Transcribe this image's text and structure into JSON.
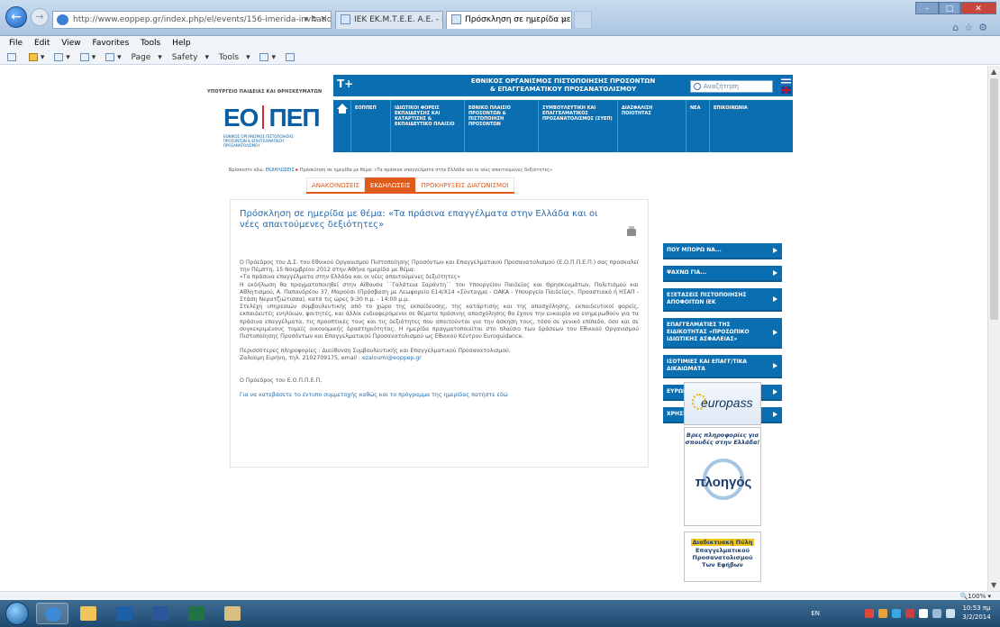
{
  "browser": {
    "address_url": "http://www.eoppep.gr/index.php/el/events/156-imerida-invitation",
    "address_host": "eoppep.gr",
    "tabs": [
      {
        "label": "ΙΕΚ ΕΚ.Μ.Τ.Ε.Ε. Α.Ε. - Ενημέρω..."
      },
      {
        "label": "Πρόσκληση σε ημερίδα με ..."
      }
    ],
    "menu": [
      "File",
      "Edit",
      "View",
      "Favorites",
      "Tools",
      "Help"
    ],
    "commands": [
      "Page",
      "Safety",
      "Tools"
    ],
    "zoom": "100%"
  },
  "site": {
    "ministry": "ΥΠΟΥΡΓΕΙΟ ΠΑΙΔΕΙΑΣ ΚΑΙ ΘΡΗΣΚΕΥΜΑΤΩΝ",
    "logo_left": "ΕΟ",
    "logo_right": "ΠΕΠ",
    "logo_sub": "ΕΘΝΙΚΟΣ ΟΡΓΑΝΙΣΜΟΣ ΠΙΣΤΟΠΟΙΗΣΗΣ ΠΡΟΣΟΝΤΩΝ & ΕΠΑΓΓΕΛΜΑΤΙΚΟΥ ΠΡΟΣΑΝΑΤΟΛΙΣΜΟΥ",
    "text_size": "T+",
    "org_line1": "ΕΘΝΙΚΟΣ ΟΡΓΑΝΙΣΜΟΣ ΠΙΣΤΟΠΟΙΗΣΗΣ ΠΡΟΣΟΝΤΩΝ",
    "org_line2": "& ΕΠΑΓΓΕΛΜΑΤΙΚΟΥ ΠΡΟΣΑΝΑΤΟΛΙΣΜΟΥ",
    "search_placeholder": "Αναζήτηση",
    "menu": [
      "ΕΟΠΠΕΠ",
      "ΙΔΙΩΤΙΚΟΙ ΦΟΡΕΙΣ ΕΚΠΑΙΔΕΥΣΗΣ ΚΑΙ ΚΑΤΑΡΤΙΣΗΣ & ΕΚΠΑΙΔΕΥΤΙΚΟ ΠΛΑΙΣΙΟ",
      "ΕΘΝΙΚΟ ΠΛΑΙΣΙΟ ΠΡΟΣΟΝΤΩΝ & ΠΙΣΤΟΠΟΙΗΣΗ ΠΡΟΣΟΝΤΩΝ",
      "ΣΥΜΒΟΥΛΕΥΤΙΚΗ ΚΑΙ ΕΠΑΓΓΕΛΜΑΤΙΚΟΣ ΠΡΟΣΑΝΑΤΟΛΙΣΜΟΣ (ΣΥΕΠ)",
      "ΔΙΑΣΦΑΛΙΣΗ ΠΟΙΟΤΗΤΑΣ",
      "ΝΕΑ",
      "ΕΠΙΚΟΙΝΩΝΙΑ"
    ]
  },
  "breadcrumb": {
    "prefix": "Βρίσκεστε εδώ:",
    "link": "ΕΚΔΗΛΩΣΕΙΣ",
    "current": "Πρόσκληση σε ημερίδα με θέμα: «Τα πράσινα επαγγέλματα στην Ελλάδα και οι νέες απαιτούμενες δεξιότητες»"
  },
  "subtabs": [
    "ΑΝΑΚΟΙΝΩΣΕΙΣ",
    "ΕΚΔΗΛΩΣΕΙΣ",
    "ΠΡΟΚΗΡΥΞΕΙΣ ΔΙΑΓΩΝΙΣΜΟΙ"
  ],
  "article": {
    "title": "Πρόσκληση σε ημερίδα με θέμα: «Τα πράσινα επαγγέλματα στην Ελλάδα και οι νέες απαιτούμενες δεξιότητες»",
    "p1": "Ο Πρόεδρος του Δ.Σ. του Εθνικού Οργανισμού Πιστοποίησης Προσόντων και Επαγγελματικού Προσανατολισμού (Ε.Ο.Π.Π.Ε.Π.) σας προσκαλεί την Πέμπτη, 15 Νοεμβρίου 2012 στην Αθήνα ημερίδα με θέμα:",
    "p2": "«Τα πράσινα επαγγέλματα στην Ελλάδα και οι νέες απαιτούμενες δεξιότητες»",
    "p3": "Η εκδήλωση θα πραγματοποιηθεί στην Αίθουσα ``Γαλάτεια Σαράντη`` του Υπουργείου Παιδείας και Θρησκευμάτων, Πολιτισμού και Αθλητισμού, Α. Παπανδρέου 37, Μαρούσι (Πρόσβαση με Λεωφορείο Ε14/Χ14 «Σύνταγμα - ΟΑΚΑ - Υπουργείο Παιδείας», Προαστιακό ή ΗΣΑΠ - Στάση Νερατζιώτισσα), κατά τις ώρες 9:30 π.μ. - 14:00 μ.μ.",
    "p4": "Στελέχη υπηρεσιών συμβουλευτικής από το χώρο της εκπαίδευσης, της κατάρτισης και της απασχόλησης, εκπαιδευτικοί φορείς, εκπαιδευτές ενηλίκων, φοιτητές, και άλλοι ενδιαφερόμενοι σε θέματα πράσινης απασχόλησης θα έχουν την ευκαιρία να ενημερωθούν για τα πράσινα επαγγέλματα, τις προοπτικές τους και τις δεξιότητες που απαιτούνται για την άσκηση τους, τόσο σε γενικό επίπεδο, όσο και σε συγκεκριμένους τομείς οικονομικής δραστηριότητας. Η ημερίδα πραγματοποιείται στο πλαίσιο των δράσεων του Εθνικού Οργανισμού Πιστοποίησης Προσόντων και Επαγγελματικού Προσανατολισμού ως Εθνικού Κέντρου Euroguidance.",
    "p5": "Περισσότερες πληροφορίες : Διεύθυνση Συμβουλευτικής και Επαγγελματικού Προσανατολισμού,",
    "p6_prefix": "Ζαλούμη Ειρήνη, τηλ. 2102709175, email :",
    "email": "ezaloumi@eoppep.gr",
    "signature": "Ο Πρόεδρος του Ε.Ο.Π.Π.Ε.Π,",
    "download_link": "Για να κατεβάσετε το έντυπο συμμετοχής καθώς και το πρόγραμμα της ημερίδας πατήστε εδώ"
  },
  "sidebar": {
    "items": [
      "ΠΟΥ ΜΠΟΡΩ ΝΑ...",
      "ΨΑΧΝΩ ΓΙΑ...",
      "ΕΞΕΤΑΣΕΙΣ ΠΙΣΤΟΠΟΙΗΣΗΣ ΑΠΟΦΟΙΤΩΝ ΙΕΚ",
      "ΕΠΑΓΓΕΛΜΑΤΙΕΣ ΤΗΣ ΕΙΔΙΚΟΤΗΤΑΣ «ΠΡΟΣΩΠΙΚΟ ΙΔΙΩΤΙΚΗΣ ΑΣΦΑΛΕΙΑΣ»",
      "ΙΣΟΤΙΜΙΕΣ ΚΑΙ ΕΠΑΓΓ/ΤΙΚΑ ΔΙΚΑΙΩΜΑΤΑ",
      "ΕΥΡΩΠΑΪΚΑ ΔΙΕΘΝΗ",
      "ΧΡΗΣΙΜΟΙ ΣΥΝΔΕΣΜΟΙ"
    ],
    "europass": "europass",
    "ploigos_top": "Βρες πληροφορίες για σπουδές στην Ελλάδα!",
    "ploigos_name": "πλοηγός",
    "portal_highlight": "Διαδικτυακή Πύλη",
    "portal_line2": "Επαγγελματικού",
    "portal_line3": "Προσανατολισμού",
    "portal_line4": "Των Εφήβων"
  },
  "taskbar": {
    "lang": "EN",
    "time": "10:53 πμ",
    "date": "3/2/2014"
  }
}
